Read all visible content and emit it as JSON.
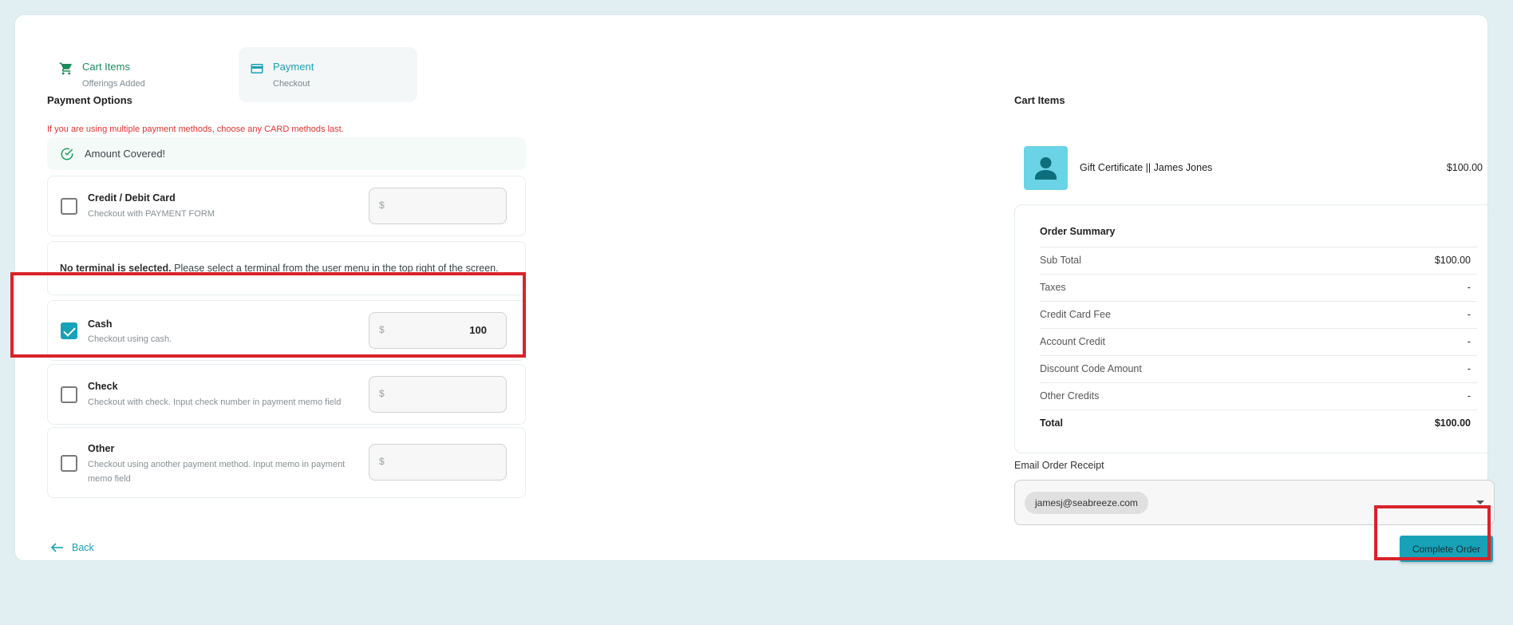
{
  "stepper": {
    "steps": [
      {
        "title": "Cart Items",
        "subtitle": "Offerings Added",
        "icon": "cart-icon"
      },
      {
        "title": "Payment",
        "subtitle": "Checkout",
        "icon": "credit-card-icon"
      }
    ]
  },
  "payment": {
    "title": "Payment Options",
    "warning": "If you are using multiple payment methods, choose any CARD methods last.",
    "status": "Amount Covered!",
    "terminal_bold": "No terminal is selected.",
    "terminal_rest": " Please select a terminal from the user menu in the top right of the screen.",
    "currency_symbol": "$",
    "methods": [
      {
        "label": "Credit / Debit Card",
        "desc": "Checkout with PAYMENT FORM",
        "checked": false,
        "amount": ""
      },
      {
        "label": "Cash",
        "desc": "Checkout using cash.",
        "checked": true,
        "amount": "100"
      },
      {
        "label": "Check",
        "desc": "Checkout with check. Input check number in payment memo field",
        "checked": false,
        "amount": ""
      },
      {
        "label": "Other",
        "desc": "Checkout using another payment method. Input memo in payment memo field",
        "checked": false,
        "amount": ""
      }
    ]
  },
  "back_label": "Back",
  "cart": {
    "title": "Cart Items",
    "item": {
      "name": "Gift Certificate || James Jones",
      "price": "$100.00",
      "icon": "person-icon"
    }
  },
  "summary": {
    "title": "Order Summary",
    "rows": [
      {
        "label": "Sub Total",
        "value": "$100.00"
      },
      {
        "label": "Taxes",
        "value": "-"
      },
      {
        "label": "Credit Card Fee",
        "value": "-"
      },
      {
        "label": "Account Credit",
        "value": "-"
      },
      {
        "label": "Discount Code Amount",
        "value": "-"
      },
      {
        "label": "Other Credits",
        "value": "-"
      },
      {
        "label": "Total",
        "value": "$100.00"
      }
    ]
  },
  "email": {
    "label": "Email Order Receipt",
    "chip": "jamesj@seabreeze.com"
  },
  "complete_label": "Complete Order",
  "colors": {
    "accent": "#17a2b8",
    "success": "#1b8b5c",
    "warning": "#e5322d",
    "highlight": "#d8232a"
  }
}
